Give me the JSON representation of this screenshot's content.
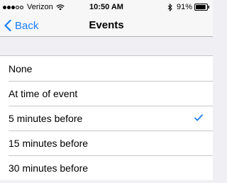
{
  "status_bar": {
    "carrier": "Verizon",
    "time": "10:50 AM",
    "battery": "91%",
    "signal_bars_filled": 3,
    "signal_bars_total": 5,
    "battery_level": 0.91
  },
  "nav": {
    "back_label": "Back",
    "title": "Events"
  },
  "options": [
    {
      "label": "None",
      "selected": false
    },
    {
      "label": "At time of event",
      "selected": false
    },
    {
      "label": "5 minutes before",
      "selected": true
    },
    {
      "label": "15 minutes before",
      "selected": false
    },
    {
      "label": "30 minutes before",
      "selected": false
    }
  ],
  "colors": {
    "accent": "#1a7ef5",
    "background": "#efeff4",
    "separator": "#c8c7cc"
  },
  "icons": {
    "wifi": "wifi-icon",
    "bluetooth": "bluetooth-icon",
    "battery": "battery-icon",
    "back": "chevron-left-icon",
    "selected": "checkmark-icon"
  }
}
